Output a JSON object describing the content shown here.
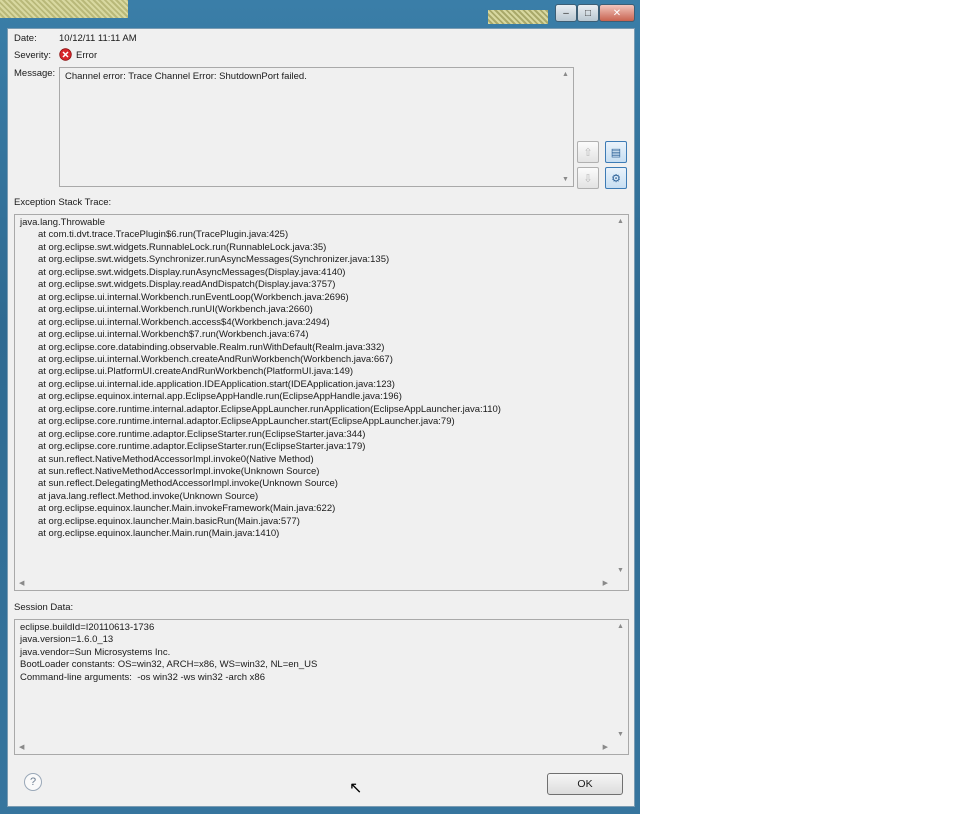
{
  "window": {
    "controls": {
      "minimize": "–",
      "maximize": "□",
      "close": "✕"
    }
  },
  "details": {
    "date_label": "Date:",
    "date_value": "10/12/11 11:11 AM",
    "severity_label": "Severity:",
    "severity_value": "Error",
    "severity_icon": "error-icon",
    "message_label": "Message:",
    "message_value": "Channel error: Trace Channel Error: ShutdownPort failed."
  },
  "side_buttons": [
    {
      "name": "previous-entry-button",
      "glyph": "⇧"
    },
    {
      "name": "copy-button",
      "glyph": "▤"
    },
    {
      "name": "next-entry-button",
      "glyph": "⇩"
    },
    {
      "name": "filter-button",
      "glyph": "⚙"
    }
  ],
  "stack": {
    "label": "Exception Stack Trace:",
    "lines": [
      "java.lang.Throwable",
      "\tat com.ti.dvt.trace.TracePlugin$6.run(TracePlugin.java:425)",
      "\tat org.eclipse.swt.widgets.RunnableLock.run(RunnableLock.java:35)",
      "\tat org.eclipse.swt.widgets.Synchronizer.runAsyncMessages(Synchronizer.java:135)",
      "\tat org.eclipse.swt.widgets.Display.runAsyncMessages(Display.java:4140)",
      "\tat org.eclipse.swt.widgets.Display.readAndDispatch(Display.java:3757)",
      "\tat org.eclipse.ui.internal.Workbench.runEventLoop(Workbench.java:2696)",
      "\tat org.eclipse.ui.internal.Workbench.runUI(Workbench.java:2660)",
      "\tat org.eclipse.ui.internal.Workbench.access$4(Workbench.java:2494)",
      "\tat org.eclipse.ui.internal.Workbench$7.run(Workbench.java:674)",
      "\tat org.eclipse.core.databinding.observable.Realm.runWithDefault(Realm.java:332)",
      "\tat org.eclipse.ui.internal.Workbench.createAndRunWorkbench(Workbench.java:667)",
      "\tat org.eclipse.ui.PlatformUI.createAndRunWorkbench(PlatformUI.java:149)",
      "\tat org.eclipse.ui.internal.ide.application.IDEApplication.start(IDEApplication.java:123)",
      "\tat org.eclipse.equinox.internal.app.EclipseAppHandle.run(EclipseAppHandle.java:196)",
      "\tat org.eclipse.core.runtime.internal.adaptor.EclipseAppLauncher.runApplication(EclipseAppLauncher.java:110)",
      "\tat org.eclipse.core.runtime.internal.adaptor.EclipseAppLauncher.start(EclipseAppLauncher.java:79)",
      "\tat org.eclipse.core.runtime.adaptor.EclipseStarter.run(EclipseStarter.java:344)",
      "\tat org.eclipse.core.runtime.adaptor.EclipseStarter.run(EclipseStarter.java:179)",
      "\tat sun.reflect.NativeMethodAccessorImpl.invoke0(Native Method)",
      "\tat sun.reflect.NativeMethodAccessorImpl.invoke(Unknown Source)",
      "\tat sun.reflect.DelegatingMethodAccessorImpl.invoke(Unknown Source)",
      "\tat java.lang.reflect.Method.invoke(Unknown Source)",
      "\tat org.eclipse.equinox.launcher.Main.invokeFramework(Main.java:622)",
      "\tat org.eclipse.equinox.launcher.Main.basicRun(Main.java:577)",
      "\tat org.eclipse.equinox.launcher.Main.run(Main.java:1410)"
    ]
  },
  "session": {
    "label": "Session Data:",
    "lines": [
      "eclipse.buildId=I20110613-1736",
      "java.version=1.6.0_13",
      "java.vendor=Sun Microsystems Inc.",
      "BootLoader constants: OS=win32, ARCH=x86, WS=win32, NL=en_US",
      "Command-line arguments:  -os win32 -ws win32 -arch x86"
    ]
  },
  "footer": {
    "help": "?",
    "ok": "OK"
  },
  "colors": {
    "accent": "#3d7bb5",
    "error": "#d8252b"
  }
}
